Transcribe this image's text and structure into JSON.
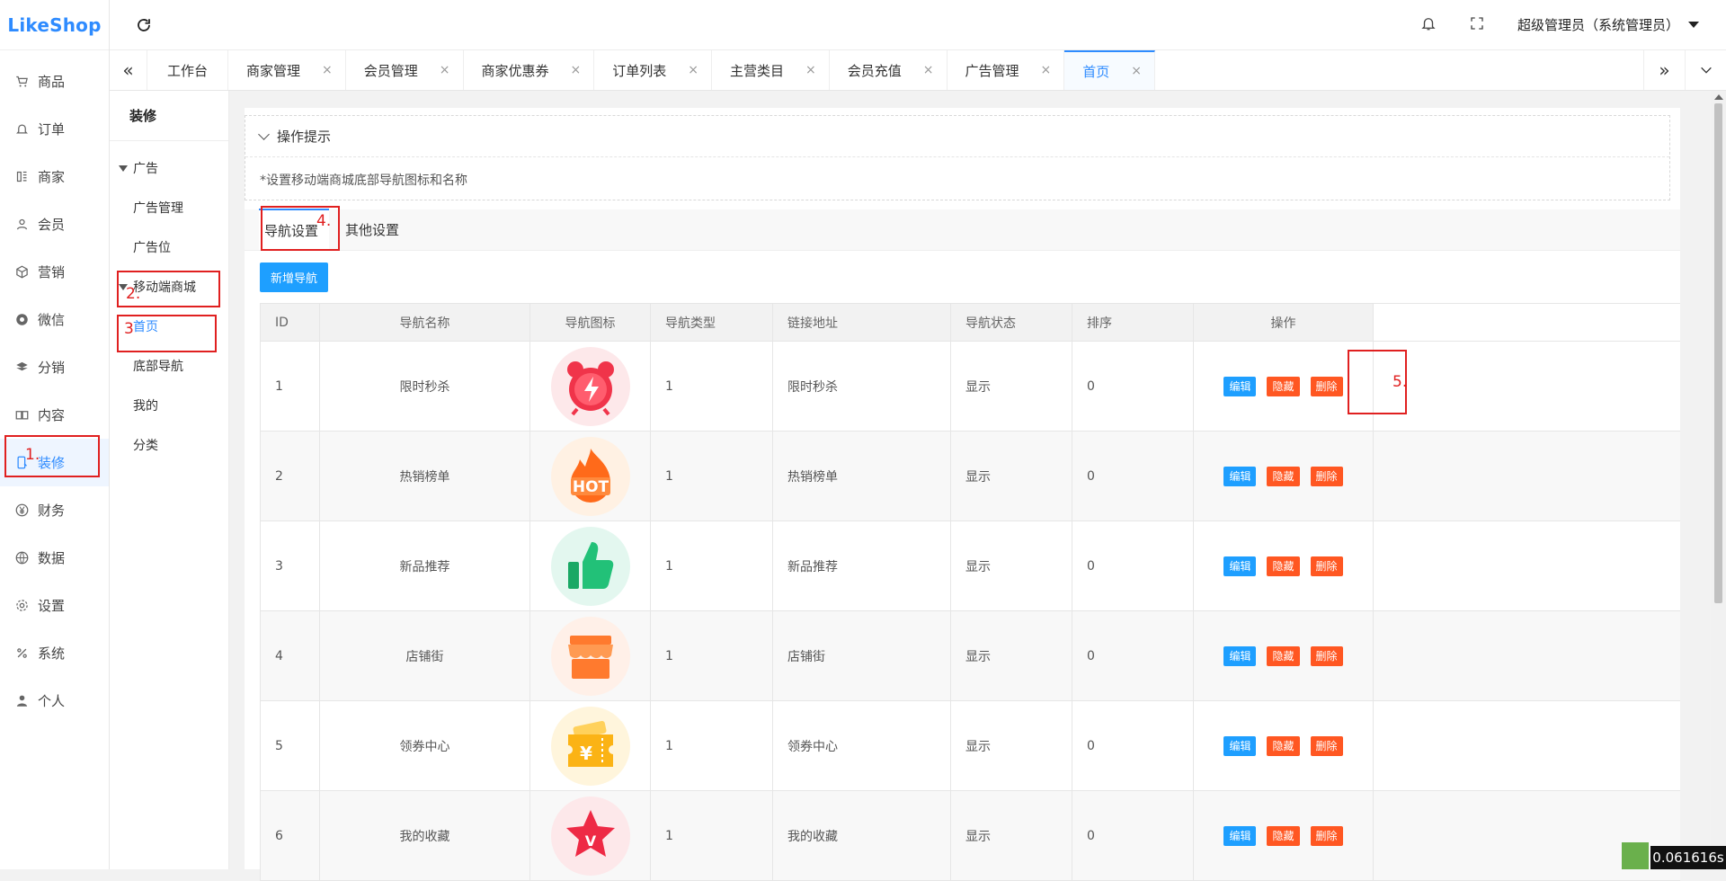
{
  "app": {
    "logo_text": "LikeShop"
  },
  "sidebar": {
    "items": [
      {
        "label": "商品",
        "icon": "cart-icon"
      },
      {
        "label": "订单",
        "icon": "bell-icon"
      },
      {
        "label": "商家",
        "icon": "store-icon"
      },
      {
        "label": "会员",
        "icon": "user-icon"
      },
      {
        "label": "营销",
        "icon": "box-icon"
      },
      {
        "label": "微信",
        "icon": "wechat-icon"
      },
      {
        "label": "分销",
        "icon": "layers-icon"
      },
      {
        "label": "内容",
        "icon": "book-icon"
      },
      {
        "label": "装修",
        "icon": "mobile-icon",
        "active": true
      },
      {
        "label": "财务",
        "icon": "yen-icon"
      },
      {
        "label": "数据",
        "icon": "globe-icon"
      },
      {
        "label": "设置",
        "icon": "gear-icon"
      },
      {
        "label": "系统",
        "icon": "percent-icon"
      },
      {
        "label": "个人",
        "icon": "person-icon"
      }
    ]
  },
  "header": {
    "user_label": "超级管理员（系统管理员）"
  },
  "tabbar": {
    "tabs": [
      {
        "label": "工作台",
        "closable": false
      },
      {
        "label": "商家管理",
        "closable": true
      },
      {
        "label": "会员管理",
        "closable": true
      },
      {
        "label": "商家优惠券",
        "closable": true
      },
      {
        "label": "订单列表",
        "closable": true
      },
      {
        "label": "主营类目",
        "closable": true
      },
      {
        "label": "会员充值",
        "closable": true
      },
      {
        "label": "广告管理",
        "closable": true
      },
      {
        "label": "首页",
        "closable": true,
        "active": true
      }
    ],
    "close_glyph": "×"
  },
  "subside": {
    "title": "装修",
    "group_ad": "广告",
    "ad_items": [
      "广告管理",
      "广告位"
    ],
    "group_mobile": "移动端商城",
    "mobile_items": [
      "首页",
      "底部导航",
      "我的",
      "分类"
    ]
  },
  "tips": {
    "title": "操作提示",
    "text": "*设置移动端商城底部导航图标和名称"
  },
  "inner_tabs": {
    "nav_settings": "导航设置",
    "other_settings": "其他设置"
  },
  "add_button": "新增导航",
  "table": {
    "headers": [
      "ID",
      "导航名称",
      "导航图标",
      "导航类型",
      "链接地址",
      "导航状态",
      "排序",
      "操作"
    ],
    "rows": [
      {
        "id": "1",
        "name": "限时秒杀",
        "icon": "alarm-clock-icon",
        "type": "1",
        "link": "限时秒杀",
        "status": "显示",
        "sort": "0",
        "icon_bg": "#fde8ea",
        "icon_color": "#f0344a"
      },
      {
        "id": "2",
        "name": "热销榜单",
        "icon": "hot-flame-icon",
        "type": "1",
        "link": "热销榜单",
        "status": "显示",
        "sort": "0",
        "icon_bg": "#fff1e3",
        "icon_color": "#ff6a1a"
      },
      {
        "id": "3",
        "name": "新品推荐",
        "icon": "thumbs-up-icon",
        "type": "1",
        "link": "新品推荐",
        "status": "显示",
        "sort": "0",
        "icon_bg": "#e3f7ef",
        "icon_color": "#22c178"
      },
      {
        "id": "4",
        "name": "店铺街",
        "icon": "storefront-icon",
        "type": "1",
        "link": "店铺街",
        "status": "显示",
        "sort": "0",
        "icon_bg": "#fff0e8",
        "icon_color": "#ff7a2e"
      },
      {
        "id": "5",
        "name": "领券中心",
        "icon": "coupon-icon",
        "type": "1",
        "link": "领券中心",
        "status": "显示",
        "sort": "0",
        "icon_bg": "#fff5dc",
        "icon_color": "#fbb315"
      },
      {
        "id": "6",
        "name": "我的收藏",
        "icon": "star-icon",
        "type": "1",
        "link": "我的收藏",
        "status": "显示",
        "sort": "0",
        "icon_bg": "#fde8ea",
        "icon_color": "#ee2a45"
      }
    ],
    "actions": {
      "edit": "编辑",
      "hide": "隐藏",
      "delete": "删除"
    }
  },
  "annotations": [
    "1.",
    "2.",
    "3",
    "4.",
    "5."
  ],
  "timer_text": "0.061616s",
  "colors": {
    "accent": "#2e8bff",
    "edit": "#1e9fff",
    "danger": "#ff5722",
    "annotation": "#e02020"
  }
}
